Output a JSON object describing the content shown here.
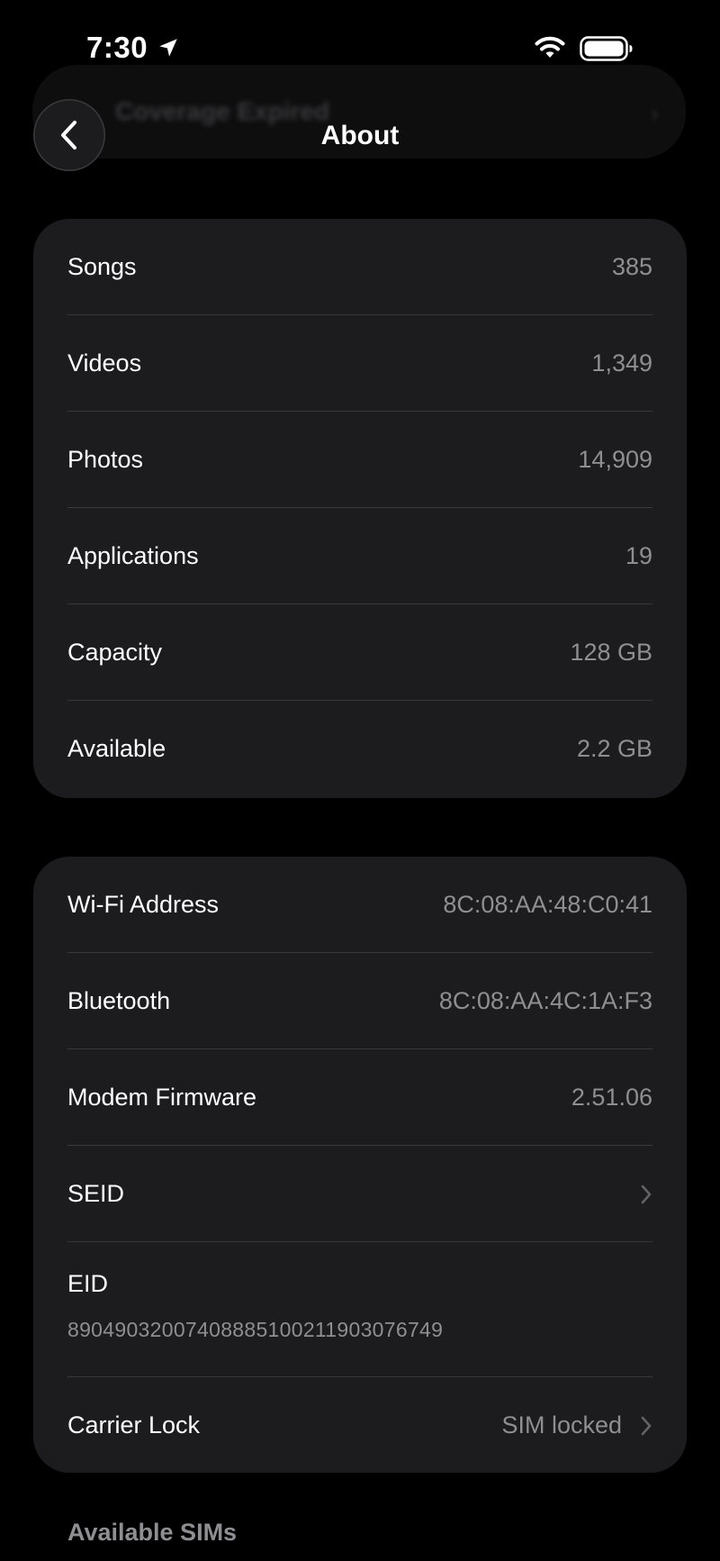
{
  "status_bar": {
    "time": "7:30",
    "location_icon": "location-arrow-icon",
    "wifi_icon": "wifi-icon",
    "battery_icon": "battery-icon"
  },
  "ghost_banner": {
    "text": "Coverage Expired"
  },
  "nav": {
    "back_icon": "chevron-left-icon",
    "title": "About"
  },
  "storage_section": {
    "rows": [
      {
        "label": "Songs",
        "value": "385"
      },
      {
        "label": "Videos",
        "value": "1,349"
      },
      {
        "label": "Photos",
        "value": "14,909"
      },
      {
        "label": "Applications",
        "value": "19"
      },
      {
        "label": "Capacity",
        "value": "128 GB"
      },
      {
        "label": "Available",
        "value": "2.2 GB"
      }
    ]
  },
  "network_section": {
    "wifi_address": {
      "label": "Wi-Fi Address",
      "value": "8C:08:AA:48:C0:41"
    },
    "bluetooth": {
      "label": "Bluetooth",
      "value": "8C:08:AA:4C:1A:F3"
    },
    "modem_firmware": {
      "label": "Modem Firmware",
      "value": "2.51.06"
    },
    "seid": {
      "label": "SEID"
    },
    "eid": {
      "label": "EID",
      "value": "89049032007408885100211903076749"
    },
    "carrier_lock": {
      "label": "Carrier Lock",
      "value": "SIM locked"
    }
  },
  "available_sims": {
    "header": "Available SIMs"
  },
  "colors": {
    "background": "#000000",
    "card": "#1c1c1e",
    "separator": "#38383a",
    "secondary_text": "#8e8e93",
    "primary_text": "#ffffff"
  }
}
